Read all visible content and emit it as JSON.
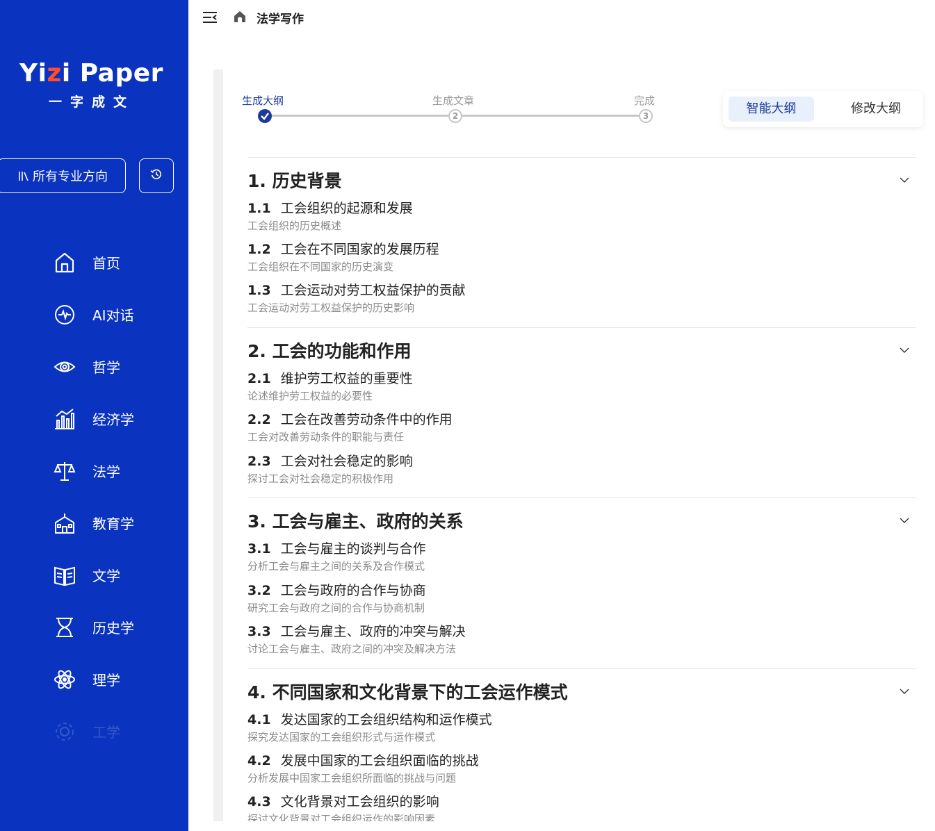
{
  "sidebar": {
    "logo_main_pre": "Yi",
    "logo_main_z": "z",
    "logo_main_i": "i",
    "logo_main_post": " Paper",
    "logo_sub": "一字成文",
    "direction_button": "所有专业方向",
    "nav": [
      {
        "label": "首页",
        "icon": "home-icon"
      },
      {
        "label": "AI对话",
        "icon": "chat-icon"
      },
      {
        "label": "哲学",
        "icon": "eye-icon"
      },
      {
        "label": "经济学",
        "icon": "bar-chart-icon"
      },
      {
        "label": "法学",
        "icon": "scales-icon"
      },
      {
        "label": "教育学",
        "icon": "school-icon"
      },
      {
        "label": "文学",
        "icon": "book-icon"
      },
      {
        "label": "历史学",
        "icon": "hourglass-icon"
      },
      {
        "label": "理学",
        "icon": "atom-icon"
      },
      {
        "label": "工学",
        "icon": "gear-icon"
      }
    ]
  },
  "header": {
    "breadcrumb": "法学写作"
  },
  "steps": [
    {
      "label": "生成大纲",
      "state": "done"
    },
    {
      "label": "生成文章",
      "num": "2",
      "state": "pending"
    },
    {
      "label": "完成",
      "num": "3",
      "state": "pending"
    }
  ],
  "tabs": {
    "active": "智能大纲",
    "inactive": "修改大纲"
  },
  "outline": [
    {
      "title": "1.  历史背景",
      "items": [
        {
          "num": "1.1",
          "title": "工会组织的起源和发展",
          "desc": "工会组织的历史概述"
        },
        {
          "num": "1.2",
          "title": "工会在不同国家的发展历程",
          "desc": "工会组织在不同国家的历史演变"
        },
        {
          "num": "1.3",
          "title": "工会运动对劳工权益保护的贡献",
          "desc": "工会运动对劳工权益保护的历史影响"
        }
      ]
    },
    {
      "title": "2.  工会的功能和作用",
      "items": [
        {
          "num": "2.1",
          "title": "维护劳工权益的重要性",
          "desc": "论述维护劳工权益的必要性"
        },
        {
          "num": "2.2",
          "title": "工会在改善劳动条件中的作用",
          "desc": "工会对改善劳动条件的职能与责任"
        },
        {
          "num": "2.3",
          "title": "工会对社会稳定的影响",
          "desc": "探讨工会对社会稳定的积极作用"
        }
      ]
    },
    {
      "title": "3.  工会与雇主、政府的关系",
      "items": [
        {
          "num": "3.1",
          "title": "工会与雇主的谈判与合作",
          "desc": "分析工会与雇主之间的关系及合作模式"
        },
        {
          "num": "3.2",
          "title": "工会与政府的合作与协商",
          "desc": "研究工会与政府之间的合作与协商机制"
        },
        {
          "num": "3.3",
          "title": "工会与雇主、政府的冲突与解决",
          "desc": "讨论工会与雇主、政府之间的冲突及解决方法"
        }
      ]
    },
    {
      "title": "4.  不同国家和文化背景下的工会运作模式",
      "items": [
        {
          "num": "4.1",
          "title": "发达国家的工会组织结构和运作模式",
          "desc": "探究发达国家的工会组织形式与运作模式"
        },
        {
          "num": "4.2",
          "title": "发展中国家的工会组织面临的挑战",
          "desc": "分析发展中国家工会组织所面临的挑战与问题"
        },
        {
          "num": "4.3",
          "title": "文化背景对工会组织的影响",
          "desc": "探讨文化背景对工会组织运作的影响因素"
        }
      ]
    }
  ],
  "colors": {
    "sidebar_bg": "#0a33bf",
    "accent": "#1b3a9a",
    "logo_dot": "#ff4d2e"
  }
}
